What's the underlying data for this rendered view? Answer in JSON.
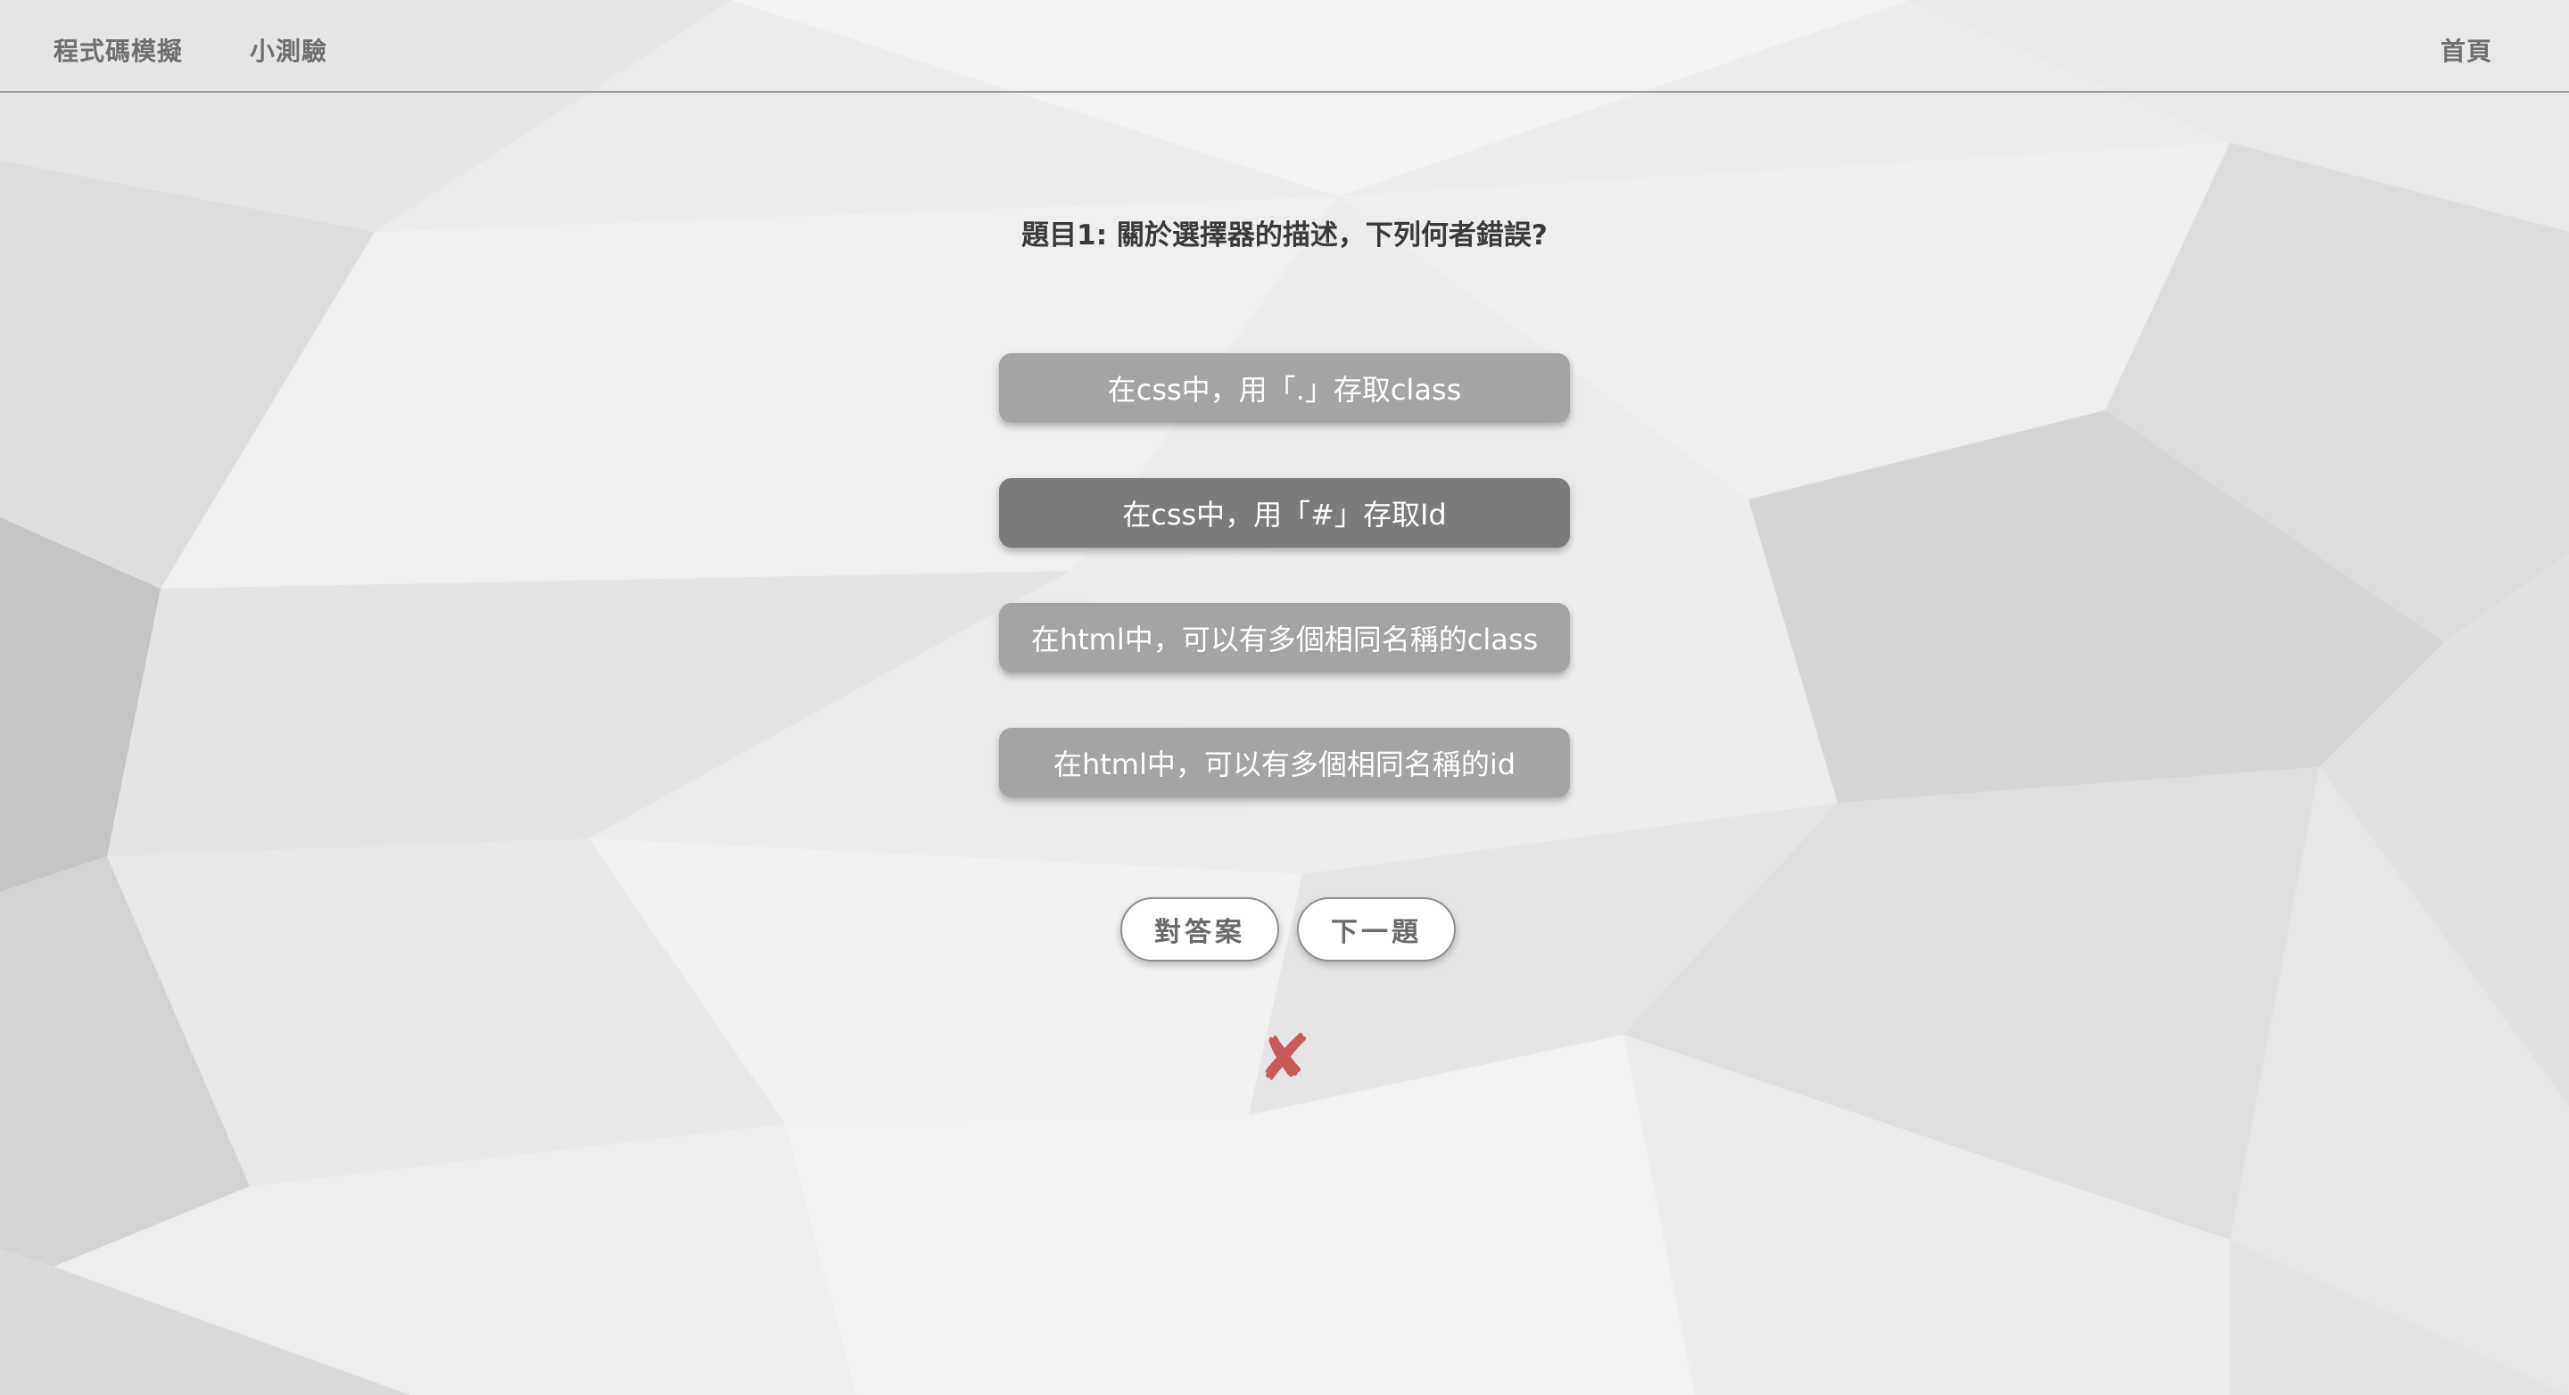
{
  "nav": {
    "simulator_label": "程式碼模擬",
    "quiz_label": "小測驗",
    "home_label": "首頁"
  },
  "quiz": {
    "question": "題目1: 關於選擇器的描述，下列何者錯誤?",
    "options": [
      {
        "label": "在css中，用「.」存取class",
        "selected": false
      },
      {
        "label": "在css中，用「#」存取Id",
        "selected": true
      },
      {
        "label": "在html中，可以有多個相同名稱的class",
        "selected": false
      },
      {
        "label": "在html中，可以有多個相同名稱的id",
        "selected": false
      }
    ],
    "answer_button_label": "對答案",
    "next_button_label": "下一題",
    "result_icon": "cross-mark-icon",
    "result_mark": "✘"
  },
  "colors": {
    "option_bg": "#a4a4a4",
    "option_selected_bg": "#7b7b7b",
    "result_mark": "#c85a5a",
    "nav_text": "#6f6f6f"
  }
}
